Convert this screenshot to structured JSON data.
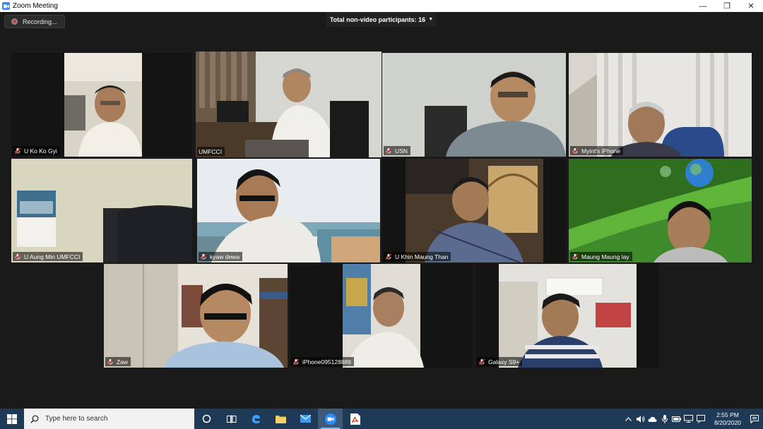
{
  "window": {
    "title": "Zoom Meeting",
    "controls": {
      "minimize": "—",
      "restore": "❐",
      "close": "✕"
    }
  },
  "recording": {
    "label": "Recording..."
  },
  "meeting": {
    "nonvideo_label": "Total non-video participants: 16",
    "active_color": "#c8dd4b"
  },
  "participants": [
    {
      "name": "U Ko Ko Gyi"
    },
    {
      "name": "UMFCCI"
    },
    {
      "name": "USN"
    },
    {
      "name": "Myint's iPhone"
    },
    {
      "name": "U Aung Min UMFCCI"
    },
    {
      "name": "kyaw dewa"
    },
    {
      "name": "U Khin Maung Than"
    },
    {
      "name": "Maung Maung lay"
    },
    {
      "name": "Zaw"
    },
    {
      "name": "iPhone095128889"
    },
    {
      "name": "Galaxy S9+"
    }
  ],
  "taskbar": {
    "search_placeholder": "Type here to search",
    "time": "2:55 PM",
    "date": "8/20/2020"
  }
}
